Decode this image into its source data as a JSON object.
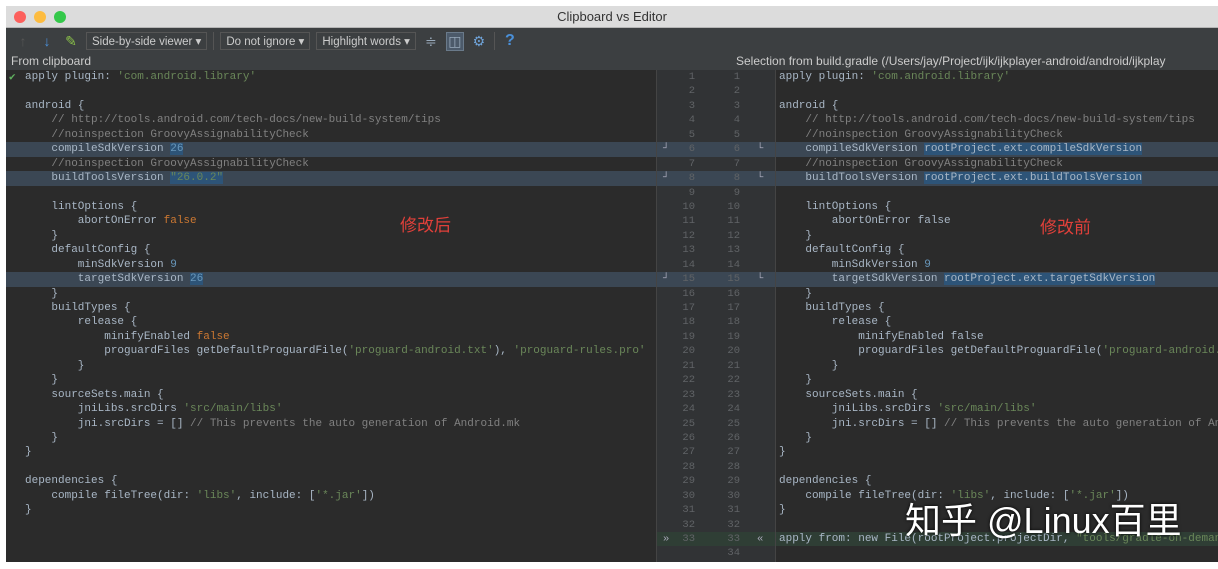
{
  "window": {
    "title": "Clipboard vs Editor"
  },
  "toolbar": {
    "viewer": "Side-by-side viewer ▾",
    "ignore": "Do not ignore ▾",
    "highlight": "Highlight words ▾",
    "help": "?"
  },
  "headers": {
    "left": "From clipboard",
    "right": "Selection from build.gradle (/Users/jay/Project/ijk/ijkplayer-android/android/ijkplay"
  },
  "annotations": {
    "left": "修改后",
    "right": "修改前"
  },
  "watermark": "知乎 @Linux百里",
  "left_gutter_marker": "»",
  "right_gutter_marker": "«",
  "left_lines": [
    [
      [
        "apply ",
        ""
      ],
      [
        "plugin",
        ""
      ],
      [
        ": ",
        ""
      ],
      [
        "'com.android.library'",
        "str"
      ]
    ],
    [],
    [
      [
        "android {",
        ""
      ]
    ],
    [
      [
        "    // http://tools.android.com/tech-docs/new-build-system/tips",
        "cm"
      ]
    ],
    [
      [
        "    //noinspection GroovyAssignabilityCheck",
        "cm"
      ]
    ],
    [
      [
        "    compileSdkVersion ",
        ""
      ],
      [
        "26",
        "num hl"
      ]
    ],
    [
      [
        "    //noinspection GroovyAssignabilityCheck",
        "cm"
      ]
    ],
    [
      [
        "    buildToolsVersion ",
        ""
      ],
      [
        "\"26.0.2\"",
        "str hl"
      ]
    ],
    [],
    [
      [
        "    lintOptions {",
        ""
      ]
    ],
    [
      [
        "        abortOnError ",
        ""
      ],
      [
        "false",
        "kw"
      ]
    ],
    [
      [
        "    }",
        ""
      ]
    ],
    [
      [
        "    defaultConfig {",
        ""
      ]
    ],
    [
      [
        "        minSdkVersion ",
        ""
      ],
      [
        "9",
        "num"
      ]
    ],
    [
      [
        "        targetSdkVersion ",
        ""
      ],
      [
        "26",
        "num hl"
      ]
    ],
    [
      [
        "    }",
        ""
      ]
    ],
    [
      [
        "    buildTypes {",
        ""
      ]
    ],
    [
      [
        "        release {",
        ""
      ]
    ],
    [
      [
        "            minifyEnabled ",
        ""
      ],
      [
        "false",
        "kw"
      ]
    ],
    [
      [
        "            proguardFiles getDefaultProguardFile(",
        ""
      ],
      [
        "'proguard-android.txt'",
        "str"
      ],
      [
        "), ",
        ""
      ],
      [
        "'proguard-rules.pro'",
        "str"
      ]
    ],
    [
      [
        "        }",
        ""
      ]
    ],
    [
      [
        "    }",
        ""
      ]
    ],
    [
      [
        "    sourceSets.main {",
        ""
      ]
    ],
    [
      [
        "        jniLibs.srcDirs ",
        ""
      ],
      [
        "'src/main/libs'",
        "str"
      ]
    ],
    [
      [
        "        jni.srcDirs = [] ",
        ""
      ],
      [
        "// This prevents the auto generation of Android.mk",
        "cm"
      ]
    ],
    [
      [
        "    }",
        ""
      ]
    ],
    [
      [
        "}",
        ""
      ]
    ],
    [],
    [
      [
        "dependencies {",
        ""
      ]
    ],
    [
      [
        "    compile fileTree(",
        ""
      ],
      [
        "dir",
        ""
      ],
      [
        ": ",
        ""
      ],
      [
        "'libs'",
        "str"
      ],
      [
        ", ",
        ""
      ],
      [
        "include",
        ""
      ],
      [
        ": [",
        ""
      ],
      [
        "'*.jar'",
        "str"
      ],
      [
        "])",
        ""
      ]
    ],
    [
      [
        "}",
        ""
      ]
    ],
    [],
    []
  ],
  "right_lines": [
    [
      [
        "apply ",
        ""
      ],
      [
        "plugin",
        ""
      ],
      [
        ": ",
        ""
      ],
      [
        "'com.android.library'",
        "str"
      ]
    ],
    [],
    [
      [
        "android {",
        ""
      ]
    ],
    [
      [
        "    // http://tools.android.com/tech-docs/new-build-system/tips",
        "cm"
      ]
    ],
    [
      [
        "    //noinspection GroovyAssignabilityCheck",
        "cm"
      ]
    ],
    [
      [
        "    compileSdkVersion ",
        ""
      ],
      [
        "rootProject.ext.compileSdkVersion",
        "hl"
      ]
    ],
    [
      [
        "    //noinspection GroovyAssignabilityCheck",
        "cm"
      ]
    ],
    [
      [
        "    buildToolsVersion ",
        ""
      ],
      [
        "rootProject.ext.buildToolsVersion",
        "hl"
      ]
    ],
    [],
    [
      [
        "    lintOptions {",
        ""
      ]
    ],
    [
      [
        "        abortOnError false",
        ""
      ]
    ],
    [
      [
        "    }",
        ""
      ]
    ],
    [
      [
        "    defaultConfig {",
        ""
      ]
    ],
    [
      [
        "        minSdkVersion ",
        ""
      ],
      [
        "9",
        "num"
      ]
    ],
    [
      [
        "        targetSdkVersion ",
        ""
      ],
      [
        "rootProject.ext.targetSdkVersion",
        "hl"
      ]
    ],
    [
      [
        "    }",
        ""
      ]
    ],
    [
      [
        "    buildTypes {",
        ""
      ]
    ],
    [
      [
        "        release {",
        ""
      ]
    ],
    [
      [
        "            minifyEnabled false",
        ""
      ]
    ],
    [
      [
        "            proguardFiles getDefaultProguardFile(",
        ""
      ],
      [
        "'proguard-android.txt'",
        "str"
      ]
    ],
    [
      [
        "        }",
        ""
      ]
    ],
    [
      [
        "    }",
        ""
      ]
    ],
    [
      [
        "    sourceSets.main {",
        ""
      ]
    ],
    [
      [
        "        jniLibs.srcDirs ",
        ""
      ],
      [
        "'src/main/libs'",
        "str"
      ]
    ],
    [
      [
        "        jni.srcDirs = [] ",
        ""
      ],
      [
        "// This prevents the auto generation of Android.mk",
        "cm"
      ]
    ],
    [
      [
        "    }",
        ""
      ]
    ],
    [
      [
        "}",
        ""
      ]
    ],
    [],
    [
      [
        "dependencies {",
        ""
      ]
    ],
    [
      [
        "    compile fileTree(dir: ",
        ""
      ],
      [
        "'libs'",
        "str"
      ],
      [
        ", include: [",
        ""
      ],
      [
        "'*.jar'",
        "str"
      ],
      [
        "])",
        ""
      ]
    ],
    [
      [
        "}",
        ""
      ]
    ],
    [],
    [
      [
        "apply from: new File(rootProject.projectDir, ",
        ""
      ],
      [
        "\"tools/gradle-on-demand.gradle\"",
        "str"
      ],
      [
        ")",
        ""
      ]
    ],
    []
  ],
  "changed_lines": [
    6,
    8,
    15
  ],
  "added_line": 33
}
